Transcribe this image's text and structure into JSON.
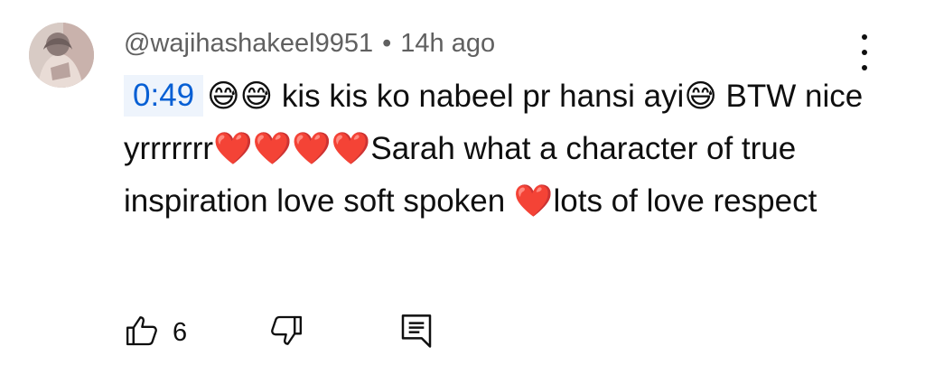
{
  "comment": {
    "author": "@wajihashakeel9951",
    "separator": "•",
    "time": "14h ago",
    "timestamp_link": "0:49",
    "text": "😅😅 kis kis ko nabeel pr hansi ayi😅 BTW nice yrrrrrrr❤️❤️❤️❤️Sarah what a character of true inspiration love soft spoken ❤️lots of love respect",
    "like_count": "6"
  },
  "icons": {
    "menu": "more-vertical-icon",
    "like": "thumbs-up-icon",
    "dislike": "thumbs-down-icon",
    "reply": "reply-icon"
  },
  "colors": {
    "text": "#0f0f0f",
    "secondary_text": "#606060",
    "timestamp_link": "#065fd4",
    "timestamp_bg": "#eef4fc"
  }
}
